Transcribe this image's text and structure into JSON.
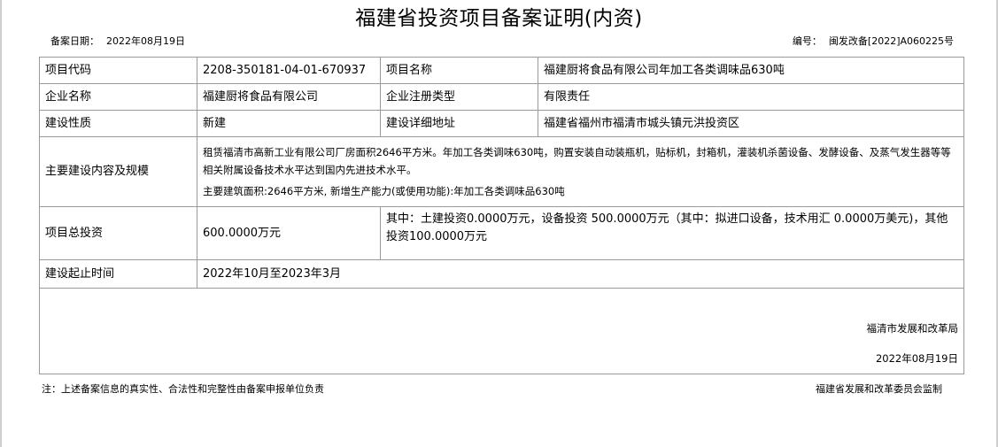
{
  "title": "福建省投资项目备案证明(内资)",
  "record_date_label": "备案日期：",
  "record_date": "2022年08月19日",
  "number_label": "编号：",
  "number": "闽发改备[2022]A060225号",
  "rows": {
    "project_code_label": "项目代码",
    "project_code": "2208-350181-04-01-670937",
    "project_name_label": "项目名称",
    "project_name": "福建厨将食品有限公司年加工各类调味品630吨",
    "company_name_label": "企业名称",
    "company_name": "福建厨将食品有限公司",
    "reg_type_label": "企业注册类型",
    "reg_type": "有限责任",
    "nature_label": "建设性质",
    "nature": "新建",
    "address_label": "建设详细地址",
    "address": "福建省福州市福清市城头镇元洪投资区",
    "scope_label": "主要建设内容及规模",
    "scope_line1": "租赁福清市高新工业有限公司厂房面积2646平方米。年加工各类调味630吨，购置安装自动装瓶机，贴标机，封箱机，灌装机杀菌设备、发酵设备、及蒸气发生器等等相关附属设备技术水平达到国内先进技术水平。",
    "scope_line2": "主要建筑面积:2646平方米, 新增生产能力(或使用功能):年加工各类调味品630吨",
    "investment_label": "项目总投资",
    "investment": "600.0000万元",
    "investment_detail": "其中：土建投资0.0000万元，设备投资 500.0000万元（其中：拟进口设备，技术用汇 0.0000万美元)，其他投资100.0000万元",
    "period_label": "建设起止时间",
    "period": "2022年10月至2023年3月"
  },
  "signature": {
    "org": "福清市发展和改革局",
    "date": "2022年08月19日"
  },
  "footer": {
    "note": "注：上述备案信息的真实性、合法性和完整性由备案申报单位负责",
    "supervisor": "福建省发展和改革委员会监制"
  }
}
